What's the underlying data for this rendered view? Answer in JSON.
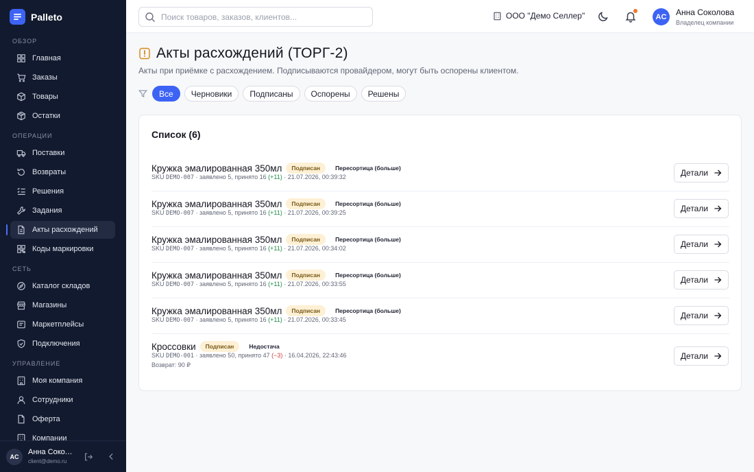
{
  "brand": {
    "name": "Palleto"
  },
  "sidebar": {
    "sections": [
      {
        "title": "ОБЗОР",
        "items": [
          {
            "label": "Главная",
            "icon": "grid-icon"
          },
          {
            "label": "Заказы",
            "icon": "cart-icon"
          },
          {
            "label": "Товары",
            "icon": "box-icon"
          },
          {
            "label": "Остатки",
            "icon": "package-icon"
          }
        ]
      },
      {
        "title": "ОПЕРАЦИИ",
        "items": [
          {
            "label": "Поставки",
            "icon": "truck-icon"
          },
          {
            "label": "Возвраты",
            "icon": "return-icon"
          },
          {
            "label": "Решения",
            "icon": "list-check-icon"
          },
          {
            "label": "Задания",
            "icon": "wrench-icon"
          },
          {
            "label": "Акты расхождений",
            "icon": "document-icon",
            "active": true
          },
          {
            "label": "Коды маркировки",
            "icon": "qr-icon"
          }
        ]
      },
      {
        "title": "СЕТЬ",
        "items": [
          {
            "label": "Каталог складов",
            "icon": "compass-icon"
          },
          {
            "label": "Магазины",
            "icon": "store-icon"
          },
          {
            "label": "Маркетплейсы",
            "icon": "marketplace-icon"
          },
          {
            "label": "Подключения",
            "icon": "shield-icon"
          }
        ]
      },
      {
        "title": "УПРАВЛЕНИЕ",
        "items": [
          {
            "label": "Моя компания",
            "icon": "building-icon"
          },
          {
            "label": "Сотрудники",
            "icon": "user-icon"
          },
          {
            "label": "Оферта",
            "icon": "file-icon"
          },
          {
            "label": "Компании",
            "icon": "building-icon"
          }
        ]
      }
    ],
    "footer": {
      "initials": "AC",
      "name": "Анна Соколова",
      "email": "client@demo.ru"
    }
  },
  "header": {
    "search_placeholder": "Поиск товаров, заказов, клиентов...",
    "org": "ООО \"Демо Селлер\"",
    "user": {
      "initials": "AC",
      "name": "Анна Соколова",
      "role": "Владелец компании"
    }
  },
  "page": {
    "title": "Акты расхождений (ТОРГ-2)",
    "subtitle": "Акты при приёмке с расхождением. Подписываются провайдером, могут быть оспорены клиентом.",
    "filters": [
      "Все",
      "Черновики",
      "Подписаны",
      "Оспорены",
      "Решены"
    ],
    "active_filter": "Все",
    "list_title": "Список (6)",
    "details_label": "Детали"
  },
  "rows": [
    {
      "name": "Кружка эмалированная 350мл",
      "status": "Подписан",
      "type": "Пересортица (больше)",
      "sku_prefix": "SKU",
      "sku": "DEMO-007",
      "qty": "· заявлено 5, принято 16",
      "diff": "(+11)",
      "diff_sign": "pos",
      "date": "· 21.07.2026, 00:39:32",
      "refund": ""
    },
    {
      "name": "Кружка эмалированная 350мл",
      "status": "Подписан",
      "type": "Пересортица (больше)",
      "sku_prefix": "SKU",
      "sku": "DEMO-007",
      "qty": "· заявлено 5, принято 16",
      "diff": "(+11)",
      "diff_sign": "pos",
      "date": "· 21.07.2026, 00:39:25",
      "refund": ""
    },
    {
      "name": "Кружка эмалированная 350мл",
      "status": "Подписан",
      "type": "Пересортица (больше)",
      "sku_prefix": "SKU",
      "sku": "DEMO-007",
      "qty": "· заявлено 5, принято 16",
      "diff": "(+11)",
      "diff_sign": "pos",
      "date": "· 21.07.2026, 00:34:02",
      "refund": ""
    },
    {
      "name": "Кружка эмалированная 350мл",
      "status": "Подписан",
      "type": "Пересортица (больше)",
      "sku_prefix": "SKU",
      "sku": "DEMO-007",
      "qty": "· заявлено 5, принято 16",
      "diff": "(+11)",
      "diff_sign": "pos",
      "date": "· 21.07.2026, 00:33:55",
      "refund": ""
    },
    {
      "name": "Кружка эмалированная 350мл",
      "status": "Подписан",
      "type": "Пересортица (больше)",
      "sku_prefix": "SKU",
      "sku": "DEMO-007",
      "qty": "· заявлено 5, принято 16",
      "diff": "(+11)",
      "diff_sign": "pos",
      "date": "· 21.07.2026, 00:33:45",
      "refund": ""
    },
    {
      "name": "Кроссовки",
      "status": "Подписан",
      "type": "Недостача",
      "sku_prefix": "SKU",
      "sku": "DEMO-001",
      "qty": "· заявлено 50, принято 47",
      "diff": "(−3)",
      "diff_sign": "neg",
      "date": "· 16.04.2026, 22:43:46",
      "refund": "Возврат: 90 ₽"
    }
  ],
  "colors": {
    "accent": "#3d63f5",
    "sidebar_bg": "#121a2f",
    "badge_bg": "#fdf0d4",
    "positive": "#1e8a4a",
    "negative": "#d23a3a",
    "notification": "#f0772b"
  }
}
